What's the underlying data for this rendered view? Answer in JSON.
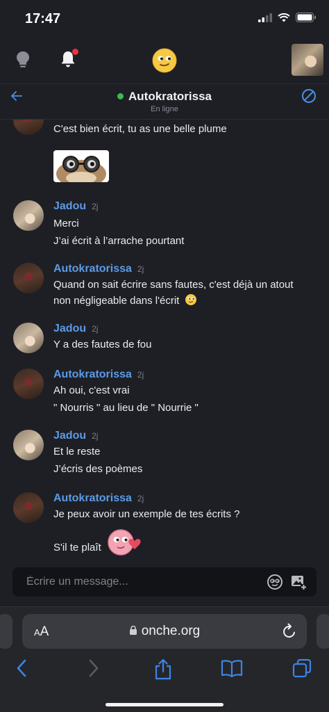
{
  "status": {
    "time": "17:47"
  },
  "conversation": {
    "name": "Autokratorissa",
    "status": "En ligne"
  },
  "messages": [
    {
      "lines": [
        "C'est bien écrit, tu as une belle plume"
      ]
    },
    {
      "author": "Jadou",
      "time": "2j",
      "lines": [
        "Merci",
        "J’ai écrit à l’arrache pourtant"
      ]
    },
    {
      "author": "Autokratorissa",
      "time": "2j",
      "lines": [
        "Quand on sait écrire sans fautes, c'est déjà un atout",
        "non négligeable dans l'écrit"
      ]
    },
    {
      "author": "Jadou",
      "time": "2j",
      "lines": [
        "Y a des fautes de fou"
      ]
    },
    {
      "author": "Autokratorissa",
      "time": "2j",
      "lines": [
        "Ah oui, c'est vrai",
        "\" Nourris \" au lieu de \" Nourrie \""
      ]
    },
    {
      "author": "Jadou",
      "time": "2j",
      "lines": [
        "Et le reste",
        "J’écris des poèmes"
      ]
    },
    {
      "author": "Autokratorissa",
      "time": "2j",
      "lines": [
        "Je peux avoir un exemple de tes écrits ?",
        "S'il te plaît"
      ]
    }
  ],
  "composer": {
    "placeholder": "Écrire un message..."
  },
  "browser": {
    "aa_label_small": "A",
    "aa_label_big": "A",
    "url": "onche.org"
  },
  "colors": {
    "accent": "#5b9be6",
    "online": "#3fb950",
    "background": "#1e1f25"
  },
  "icons": [
    "lightbulb-icon",
    "bell-icon",
    "smiley-logo-icon",
    "back-arrow-icon",
    "block-icon",
    "emoji-icon",
    "add-image-icon",
    "lock-icon",
    "reload-icon",
    "back-icon",
    "forward-icon",
    "share-icon",
    "bookmarks-icon",
    "tabs-icon"
  ]
}
